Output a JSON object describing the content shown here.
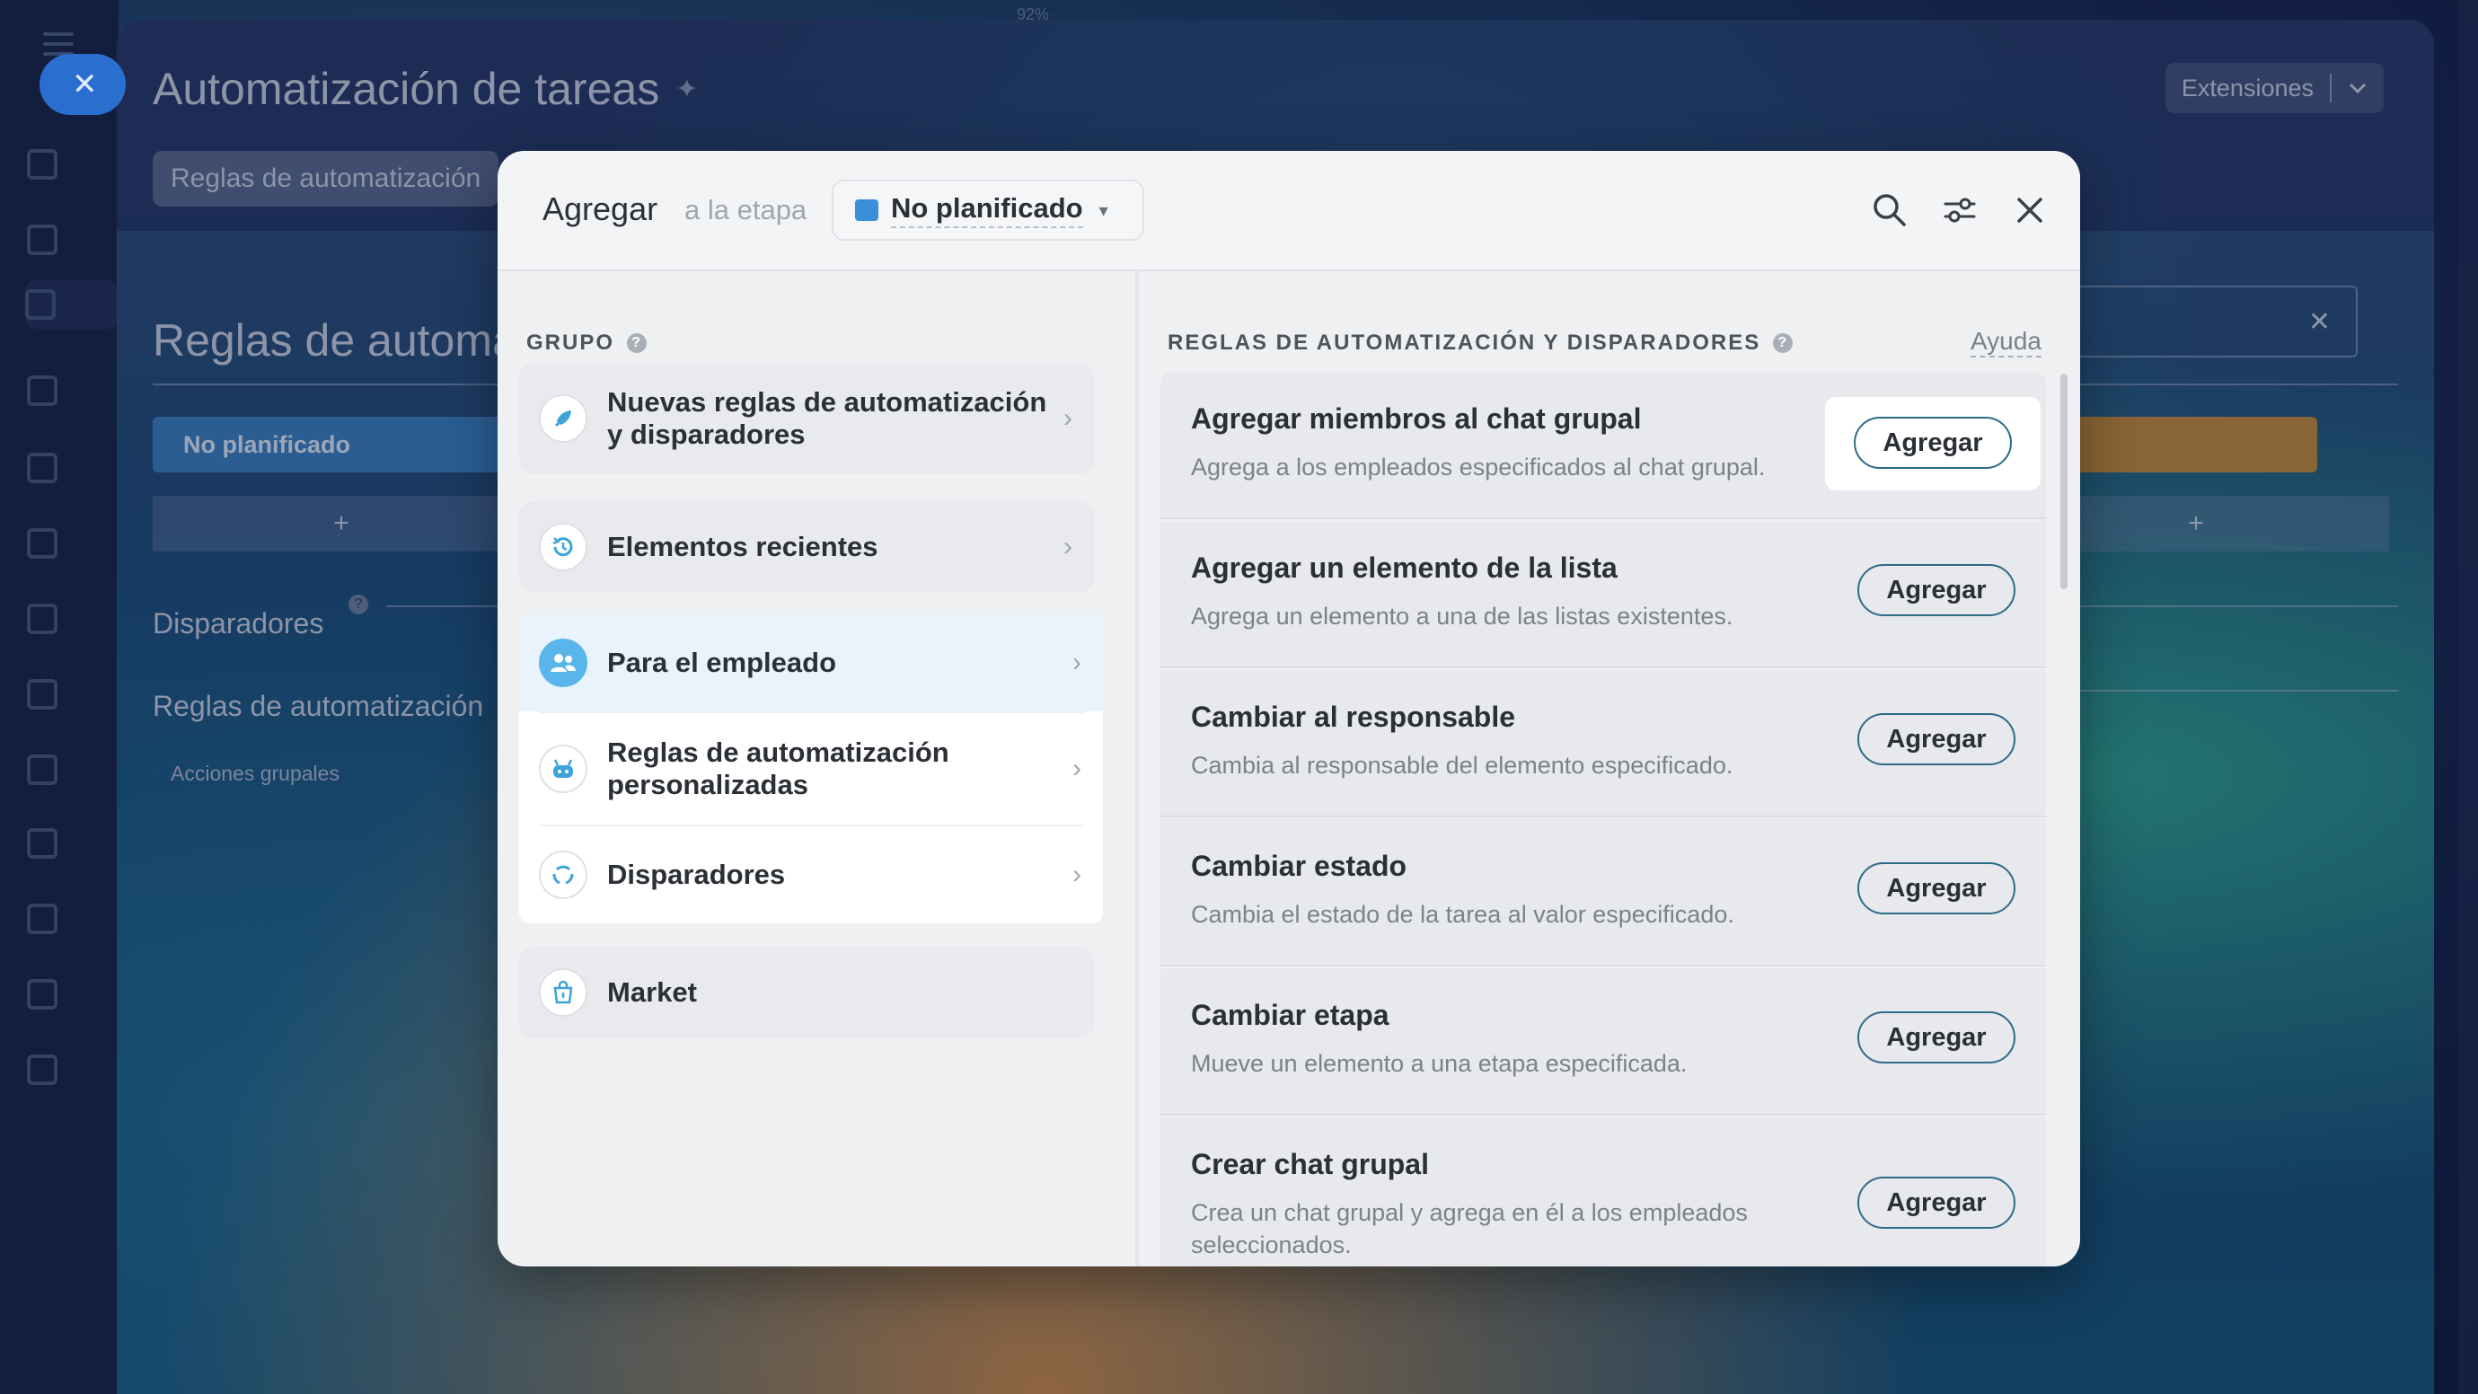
{
  "background": {
    "zoom": "92%",
    "title": "Automatización de tareas",
    "extensions_label": "Extensiones",
    "tab_label": "Reglas de automatización",
    "heading": "Reglas de automa",
    "stage_label": "No planificado",
    "plus": "+",
    "triggers_label": "Disparadores",
    "rules_label": "Reglas de automatización",
    "group_actions": "Acciones grupales",
    "search_clear": "✕"
  },
  "close_fab": "✕",
  "modal": {
    "title": "Agregar",
    "subtitle": "a la etapa",
    "stage": "No planificado",
    "stage_color": "#3b8fd8",
    "icons": [
      "search-icon",
      "filter-icon",
      "close-icon"
    ]
  },
  "groups": {
    "label": "GRUPO",
    "items": [
      {
        "label": "Nuevas reglas de automatización y disparadores",
        "icon": "rocket-icon"
      },
      {
        "label": "Elementos recientes",
        "icon": "history-icon"
      },
      {
        "label": "Para el empleado",
        "icon": "users-icon"
      },
      {
        "label": "Reglas de automatización personalizadas",
        "icon": "robot-icon"
      },
      {
        "label": "Disparadores",
        "icon": "cycle-icon"
      },
      {
        "label": "Market",
        "icon": "market-icon"
      }
    ]
  },
  "rules": {
    "label": "REGLAS DE AUTOMATIZACIÓN Y DISPARADORES",
    "help_link": "Ayuda",
    "button_label": "Agregar",
    "items": [
      {
        "title": "Agregar miembros al chat grupal",
        "desc": "Agrega a los empleados especificados al chat grupal."
      },
      {
        "title": "Agregar un elemento de la lista",
        "desc": "Agrega un elemento a una de las listas existentes."
      },
      {
        "title": "Cambiar al responsable",
        "desc": "Cambia al responsable del elemento especificado."
      },
      {
        "title": "Cambiar estado",
        "desc": "Cambia el estado de la tarea al valor especificado."
      },
      {
        "title": "Cambiar etapa",
        "desc": "Mueve un elemento a una etapa especificada."
      },
      {
        "title": "Crear chat grupal",
        "desc": "Crea un chat grupal y agrega en él a los empleados seleccionados."
      }
    ]
  }
}
